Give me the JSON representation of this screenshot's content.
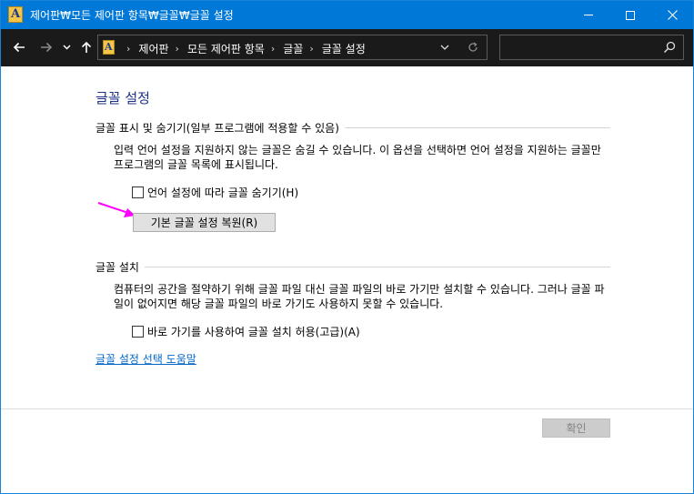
{
  "window": {
    "title": "제어판₩모든 제어판 항목₩글꼴₩글꼴 설정",
    "colors": {
      "titlebar": "#0078d7",
      "navbar": "#1a1a1a",
      "accent_text": "#1e3287",
      "link": "#0066cc",
      "annotation_arrow": "#ff00ff"
    },
    "app_icon": "font-folder-icon"
  },
  "navigation": {
    "breadcrumb": [
      "제어판",
      "모든 제어판 항목",
      "글꼴",
      "글꼴 설정"
    ],
    "search_placeholder": ""
  },
  "content": {
    "page_title": "글꼴 설정",
    "section1": {
      "heading": "글꼴 표시 및 숨기기(일부 프로그램에 적용할 수 있음)",
      "description": "입력 언어 설정을 지원하지 않는 글꼴은 숨길 수 있습니다. 이 옵션을 선택하면 언어 설정을 지원하는 글꼴만 프로그램의 글꼴 목록에 표시됩니다.",
      "checkbox_label": "언어 설정에 따라 글꼴 숨기기(H)",
      "checkbox_checked": false,
      "restore_button": "기본 글꼴 설정 복원(R)"
    },
    "section2": {
      "heading": "글꼴 설치",
      "description": "컴퓨터의 공간을 절약하기 위해 글꼴 파일 대신 글꼴 파일의 바로 가기만 설치할 수 있습니다. 그러나 글꼴 파일이 없어지면 해당 글꼴 파일의 바로 가기도 사용하지 못할 수 있습니다.",
      "checkbox_label": "바로 가기를 사용하여 글꼴 설치 허용(고급)(A)",
      "checkbox_checked": false
    },
    "help_link": "글꼴 설정 선택 도움말"
  },
  "footer": {
    "ok_button": "확인"
  }
}
